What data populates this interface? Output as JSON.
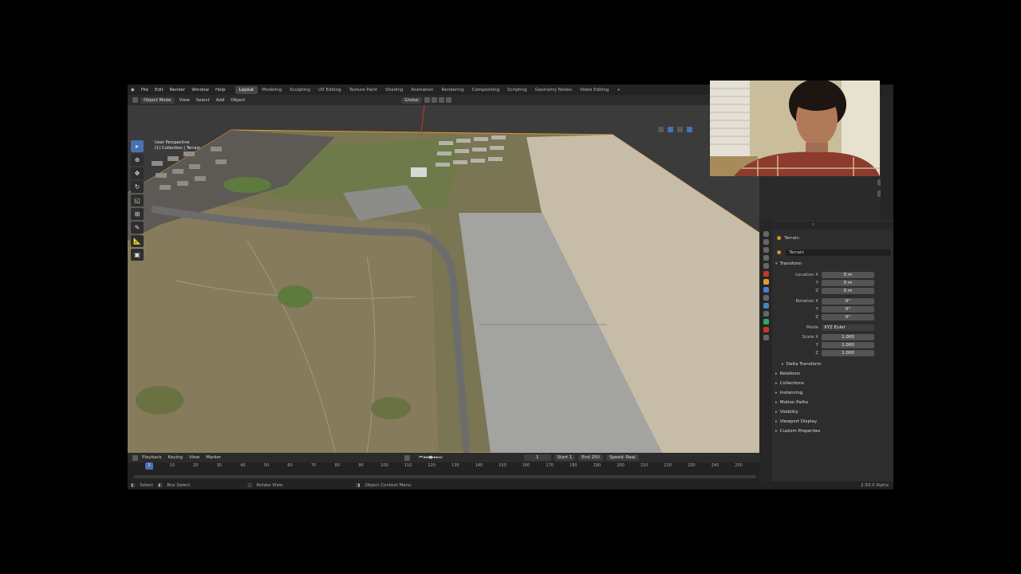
{
  "topbar": {
    "menu": [
      "File",
      "Edit",
      "Render",
      "Window",
      "Help"
    ],
    "workspaces": [
      "Layout",
      "Modeling",
      "Sculpting",
      "UV Editing",
      "Texture Paint",
      "Shading",
      "Animation",
      "Rendering",
      "Compositing",
      "Scripting",
      "Geometry Nodes",
      "Video Editing"
    ],
    "add_tab": "+"
  },
  "header": {
    "mode": "Object Mode",
    "menus": [
      "View",
      "Select",
      "Add",
      "Object"
    ],
    "transform_orientation": "Global"
  },
  "viewport": {
    "perspective": "User Perspective",
    "collection": "(1) Collection | Terrain"
  },
  "timeline": {
    "menus": [
      "Playback",
      "Keying",
      "View",
      "Marker"
    ],
    "current_frame": "1",
    "start_label": "Start",
    "start": "1",
    "end_label": "End",
    "end": "250",
    "speed": "Speed: Real",
    "ticks": [
      "0",
      "10",
      "20",
      "30",
      "40",
      "50",
      "60",
      "70",
      "80",
      "90",
      "100",
      "110",
      "120",
      "130",
      "140",
      "150",
      "160",
      "170",
      "180",
      "190",
      "200",
      "210",
      "220",
      "230",
      "240",
      "250"
    ]
  },
  "statusbar": {
    "select": "Select",
    "box_select": "Box Select",
    "rotate": "Rotate View",
    "context": "Object Context Menu",
    "version": "2.93.0 Alpha"
  },
  "properties": {
    "object_name": "Terrain",
    "object_field": "Terrain",
    "transform_title": "Transform",
    "location": {
      "label_x": "Location X",
      "label_y": "Y",
      "label_z": "Z",
      "x": "0 m",
      "y": "0 m",
      "z": "0 m"
    },
    "rotation": {
      "label_x": "Rotation X",
      "label_y": "Y",
      "label_z": "Z",
      "x": "0°",
      "y": "0°",
      "z": "0°"
    },
    "mode": {
      "label": "Mode",
      "value": "XYZ Euler"
    },
    "scale": {
      "label_x": "Scale X",
      "label_y": "Y",
      "label_z": "Z",
      "x": "1.000",
      "y": "1.000",
      "z": "1.000"
    },
    "delta_transform": "Delta Transform",
    "sections": [
      "Relations",
      "Collections",
      "Instancing",
      "Motion Paths",
      "Visibility",
      "Viewport Display",
      "Custom Properties"
    ]
  }
}
